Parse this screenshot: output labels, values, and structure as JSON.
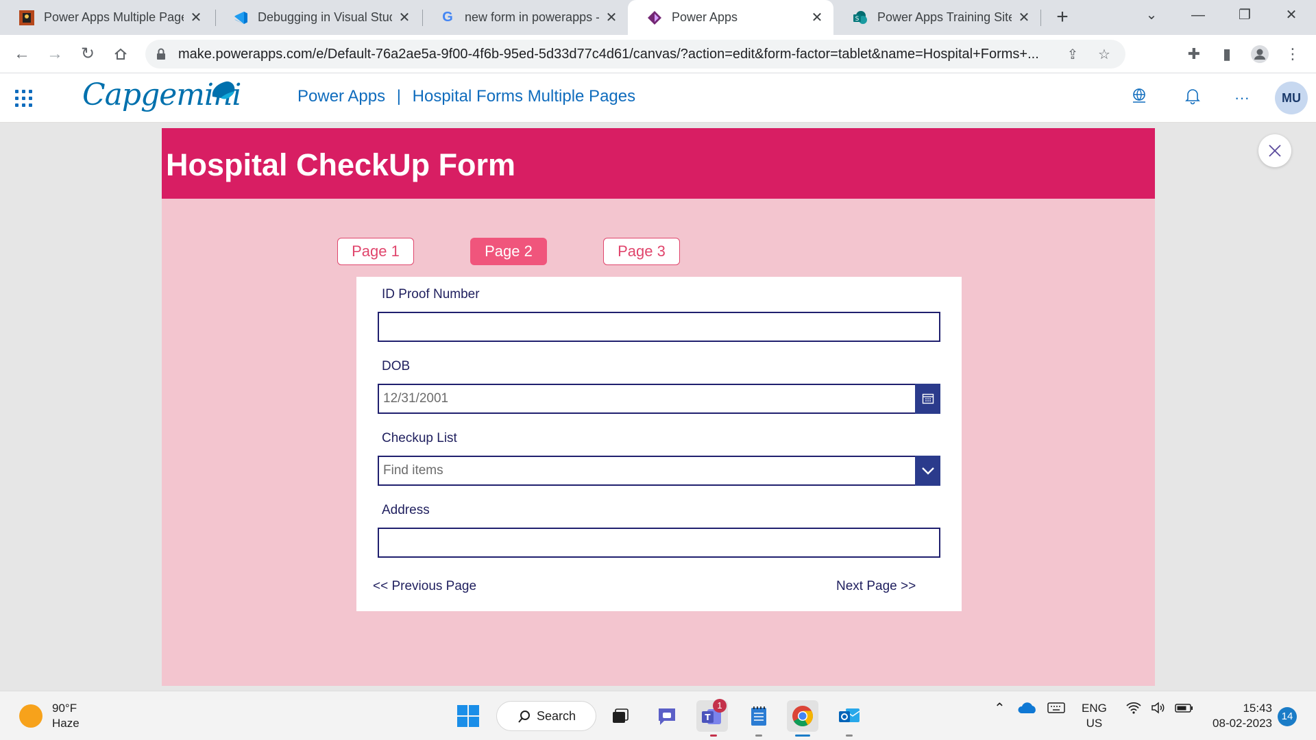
{
  "browser": {
    "tabs": [
      {
        "title": "Power Apps Multiple Pages",
        "active": false
      },
      {
        "title": "Debugging in Visual Studio",
        "active": false
      },
      {
        "title": "new form in powerapps - Google",
        "active": false
      },
      {
        "title": "Power Apps",
        "active": true
      },
      {
        "title": "Power Apps Training Site",
        "active": false
      }
    ],
    "new_tab_label": "+",
    "url": "make.powerapps.com/e/Default-76a2ae5a-9f00-4f6b-95ed-5d33d77c4d61/canvas/?action=edit&form-factor=tablet&name=Hospital+Forms+..."
  },
  "header": {
    "brand": "Capgemini",
    "product": "Power Apps",
    "separator": "|",
    "app_name": "Hospital Forms Multiple Pages",
    "avatar_initials": "MU",
    "more_label": "···"
  },
  "app": {
    "title": "Hospital CheckUp Form",
    "pages": [
      {
        "label": "Page 1",
        "active": false
      },
      {
        "label": "Page 2",
        "active": true
      },
      {
        "label": "Page 3",
        "active": false
      }
    ],
    "fields": {
      "id_proof": {
        "label": "ID Proof Number",
        "value": ""
      },
      "dob": {
        "label": "DOB",
        "value": "12/31/2001"
      },
      "checkup": {
        "label": "Checkup List",
        "placeholder": "Find items"
      },
      "address": {
        "label": "Address",
        "value": ""
      }
    },
    "prev_label": "<< Previous Page",
    "next_label": "Next Page >>",
    "colors": {
      "header": "#d81e63",
      "canvas": "#f3c5cf",
      "active_page": "#f0557c",
      "field_border": "#1f1f6e"
    }
  },
  "taskbar": {
    "weather_temp": "90°F",
    "weather_desc": "Haze",
    "search_label": "Search",
    "teams_badge": "1",
    "lang_top": "ENG",
    "lang_bottom": "US",
    "time": "15:43",
    "date": "08-02-2023",
    "notification_count": "14"
  }
}
